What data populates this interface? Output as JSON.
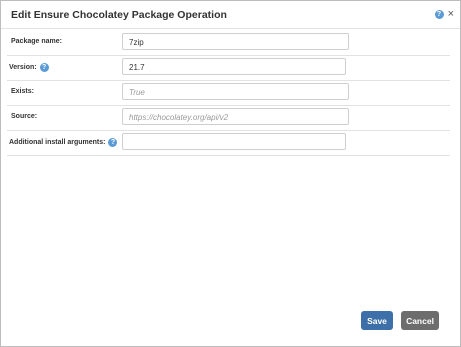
{
  "dialog": {
    "title": "Edit Ensure Chocolatey Package Operation",
    "help_icon": "question-circle-icon",
    "close_icon": "close-icon",
    "close_glyph": "×"
  },
  "fields": [
    {
      "label": "Package name:",
      "value": "7zip",
      "placeholder": ""
    },
    {
      "label": "Version:",
      "value": "21.7",
      "placeholder": "",
      "has_help": true
    },
    {
      "label": "Exists:",
      "value": "",
      "placeholder": "True"
    },
    {
      "label": "Source:",
      "value": "",
      "placeholder": "https://chocolatey.org/api/v2"
    },
    {
      "label": "Additional install arguments:",
      "value": "",
      "placeholder": "",
      "has_help": true
    }
  ],
  "buttons": {
    "save": "Save",
    "cancel": "Cancel"
  },
  "colors": {
    "primary": "#3d6fa8",
    "secondary": "#6d6d6d",
    "help": "#5b9bd5"
  }
}
